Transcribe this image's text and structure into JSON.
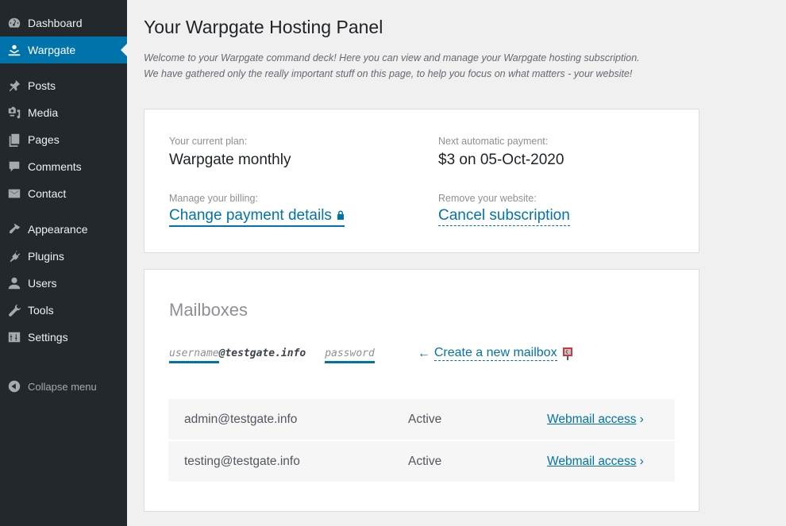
{
  "sidebar": {
    "items": [
      {
        "label": "Dashboard",
        "icon": "dashboard-icon"
      },
      {
        "label": "Warpgate",
        "icon": "warpgate-icon",
        "active": true
      },
      {
        "label": "Posts",
        "icon": "pin-icon"
      },
      {
        "label": "Media",
        "icon": "media-icon"
      },
      {
        "label": "Pages",
        "icon": "pages-icon"
      },
      {
        "label": "Comments",
        "icon": "comment-icon"
      },
      {
        "label": "Contact",
        "icon": "envelope-icon"
      },
      {
        "label": "Appearance",
        "icon": "brush-icon"
      },
      {
        "label": "Plugins",
        "icon": "plug-icon"
      },
      {
        "label": "Users",
        "icon": "user-icon"
      },
      {
        "label": "Tools",
        "icon": "wrench-icon"
      },
      {
        "label": "Settings",
        "icon": "sliders-icon"
      }
    ],
    "collapse_label": "Collapse menu"
  },
  "page": {
    "title": "Your Warpgate Hosting Panel",
    "intro_line1": "Welcome to your Warpgate command deck! Here you can view and manage your Warpgate hosting subscription.",
    "intro_line2": "We have gathered only the really important stuff on this page, to help you focus on what matters - your website!"
  },
  "plan": {
    "current_plan_label": "Your current plan:",
    "current_plan_value": "Warpgate monthly",
    "next_payment_label": "Next automatic payment:",
    "next_payment_value": "$3 on 05-Oct-2020",
    "billing_label": "Manage your billing:",
    "billing_link": "Change payment details",
    "remove_label": "Remove your website:",
    "remove_link": "Cancel subscription"
  },
  "mailboxes": {
    "title": "Mailboxes",
    "username_placeholder": "username",
    "domain": "@testgate.info",
    "password_placeholder": "password",
    "create_arrow": "←",
    "create_label": "Create a new mailbox",
    "rows": [
      {
        "email": "admin@testgate.info",
        "status": "Active",
        "link": "Webmail access",
        "chevron": "›"
      },
      {
        "email": "testing@testgate.info",
        "status": "Active",
        "link": "Webmail access",
        "chevron": "›"
      }
    ]
  },
  "colors": {
    "accent": "#0073aa",
    "sidebar_bg": "#23282d",
    "page_bg": "#f0f0f1"
  }
}
